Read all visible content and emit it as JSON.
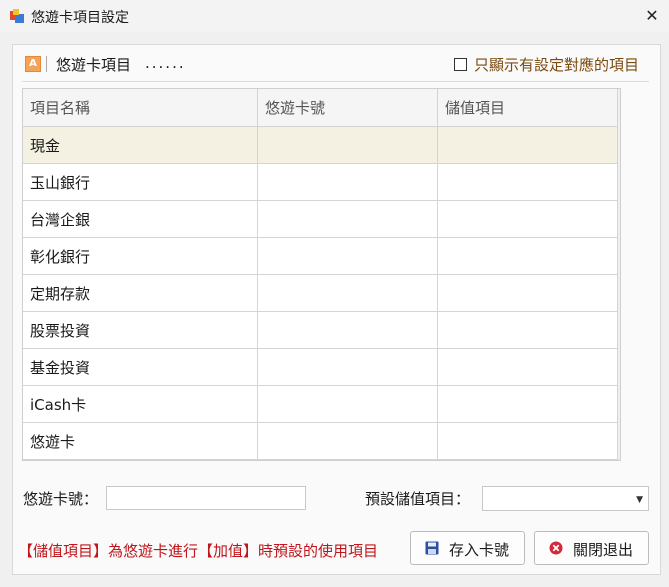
{
  "window": {
    "title": "悠遊卡項目設定"
  },
  "header": {
    "label": "悠遊卡項目",
    "dots": "......",
    "checkbox_label": "只顯示有設定對應的項目"
  },
  "grid": {
    "columns": [
      "項目名稱",
      "悠遊卡號",
      "儲值項目"
    ],
    "rows": [
      [
        "現金",
        "",
        ""
      ],
      [
        "玉山銀行",
        "",
        ""
      ],
      [
        "台灣企銀",
        "",
        ""
      ],
      [
        "彰化銀行",
        "",
        ""
      ],
      [
        "定期存款",
        "",
        ""
      ],
      [
        "股票投資",
        "",
        ""
      ],
      [
        "基金投資",
        "",
        ""
      ],
      [
        "iCash卡",
        "",
        ""
      ],
      [
        "悠遊卡",
        "",
        ""
      ]
    ]
  },
  "form": {
    "card_label": "悠遊卡號：",
    "card_value": "",
    "default_label": "預設儲值項目：",
    "default_value": ""
  },
  "footer": {
    "note": "【儲值項目】為悠遊卡進行【加值】時預設的使用項目",
    "save_label": "存入卡號",
    "close_label": "關閉退出"
  }
}
